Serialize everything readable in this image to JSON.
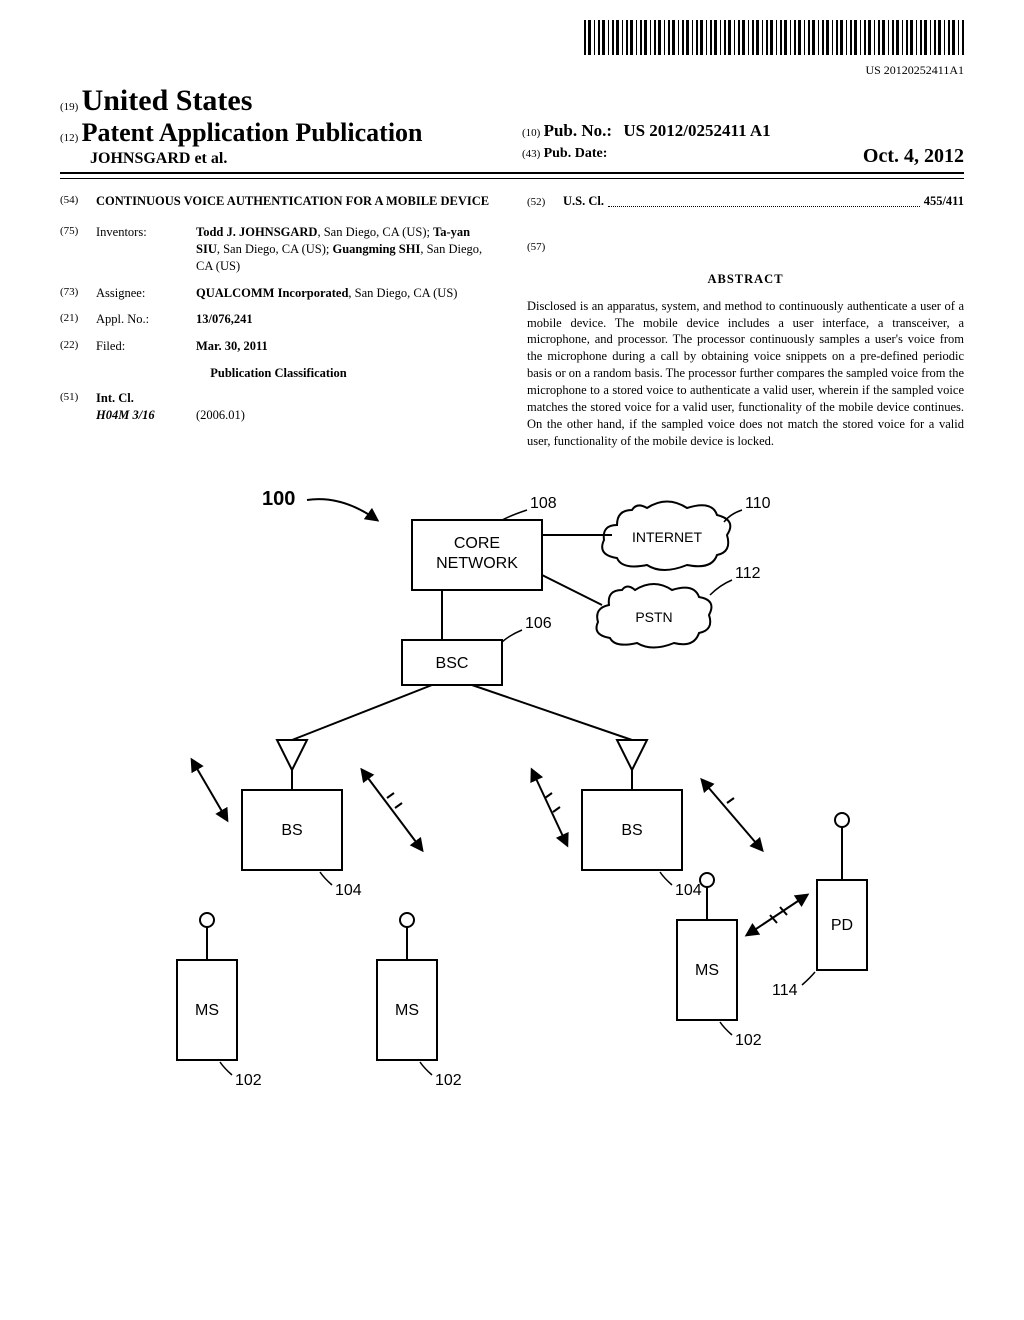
{
  "barcode_number": "US 20120252411A1",
  "header": {
    "country_code": "(19)",
    "country": "United States",
    "doc_type_code": "(12)",
    "doc_type": "Patent Application Publication",
    "authors": "JOHNSGARD et al.",
    "pubno_code": "(10)",
    "pubno_label": "Pub. No.:",
    "pubno_value": "US 2012/0252411 A1",
    "pubdate_code": "(43)",
    "pubdate_label": "Pub. Date:",
    "pubdate_value": "Oct. 4, 2012"
  },
  "left": {
    "title_code": "(54)",
    "title": "CONTINUOUS VOICE AUTHENTICATION FOR A MOBILE DEVICE",
    "inventors_code": "(75)",
    "inventors_label": "Inventors:",
    "inventors_value": "Todd J. JOHNSGARD, San Diego, CA (US); Ta-yan SIU, San Diego, CA (US); Guangming SHI, San Diego, CA (US)",
    "assignee_code": "(73)",
    "assignee_label": "Assignee:",
    "assignee_value": "QUALCOMM Incorporated, San Diego, CA (US)",
    "applno_code": "(21)",
    "applno_label": "Appl. No.:",
    "applno_value": "13/076,241",
    "filed_code": "(22)",
    "filed_label": "Filed:",
    "filed_value": "Mar. 30, 2011",
    "pub_class": "Publication Classification",
    "intcl_code": "(51)",
    "intcl_label": "Int. Cl.",
    "intcl_class": "H04M 3/16",
    "intcl_year": "(2006.01)"
  },
  "right": {
    "uscl_code": "(52)",
    "uscl_label": "U.S. Cl.",
    "uscl_value": "455/411",
    "abstract_code": "(57)",
    "abstract_title": "ABSTRACT",
    "abstract_body": "Disclosed is an apparatus, system, and method to continuously authenticate a user of a mobile device. The mobile device includes a user interface, a transceiver, a microphone, and processor. The processor continuously samples a user's voice from the microphone during a call by obtaining voice snippets on a pre-defined periodic basis or on a random basis. The processor further compares the sampled voice from the microphone to a stored voice to authenticate a valid user, wherein if the sampled voice matches the stored voice for a valid user, functionality of the mobile device continues. On the other hand, if the sampled voice does not match the stored voice for a valid user, functionality of the mobile device is locked."
  },
  "figure": {
    "ref_100": "100",
    "core_network": "CORE\nNETWORK",
    "internet": "INTERNET",
    "pstn": "PSTN",
    "bsc": "BSC",
    "bs": "BS",
    "ms": "MS",
    "pd": "PD",
    "ref_108": "108",
    "ref_110": "110",
    "ref_112": "112",
    "ref_106": "106",
    "ref_104": "104",
    "ref_102": "102",
    "ref_114": "114"
  }
}
